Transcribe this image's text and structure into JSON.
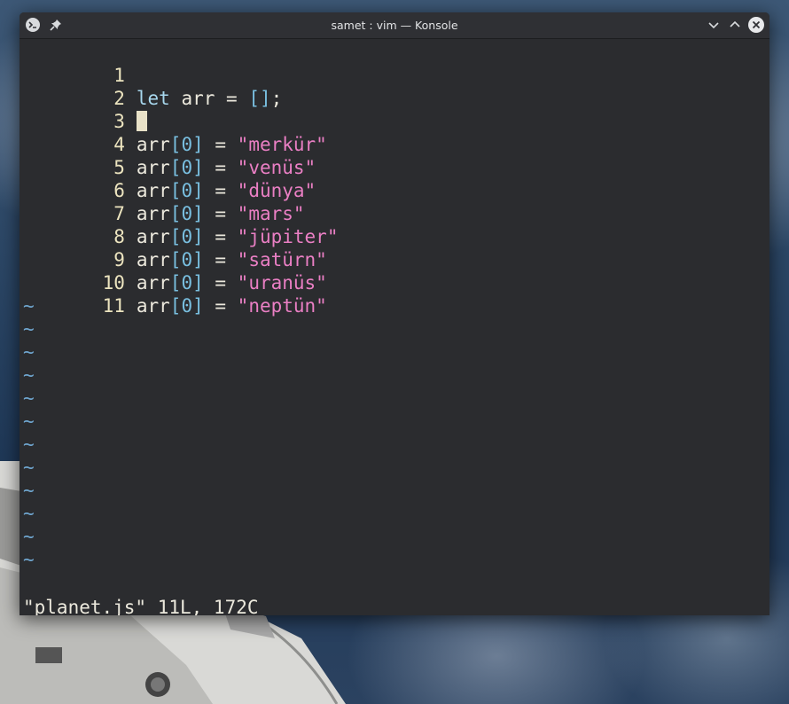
{
  "window": {
    "title": "samet : vim — Konsole"
  },
  "icons": {
    "app": "terminal-app-icon",
    "pin": "pin-icon",
    "minimize": "chevron-down-icon",
    "maximize": "chevron-up-icon",
    "close": "close-icon"
  },
  "editor": {
    "lines": [
      {
        "num": "1",
        "text": ""
      },
      {
        "num": "2",
        "kw": "let",
        "mid": " arr = ",
        "br": "[]",
        "end": ";"
      },
      {
        "num": "3",
        "text": ""
      },
      {
        "num": "4",
        "pre": "arr",
        "idx": "[0]",
        "eq": " = ",
        "str": "\"merkür\""
      },
      {
        "num": "5",
        "pre": "arr",
        "idx": "[0]",
        "eq": " = ",
        "str": "\"venüs\""
      },
      {
        "num": "6",
        "pre": "arr",
        "idx": "[0]",
        "eq": " = ",
        "str": "\"dünya\""
      },
      {
        "num": "7",
        "pre": "arr",
        "idx": "[0]",
        "eq": " = ",
        "str": "\"mars\""
      },
      {
        "num": "8",
        "pre": "arr",
        "idx": "[0]",
        "eq": " = ",
        "str": "\"jüpiter\""
      },
      {
        "num": "9",
        "pre": "arr",
        "idx": "[0]",
        "eq": " = ",
        "str": "\"satürn\""
      },
      {
        "num": "10",
        "pre": "arr",
        "idx": "[0]",
        "eq": " = ",
        "str": "\"uranüs\""
      },
      {
        "num": "11",
        "pre": "arr",
        "idx": "[0]",
        "eq": " = ",
        "str": "\"neptün\""
      }
    ],
    "tilde": "~",
    "status": "\"planet.js\" 11L, 172C"
  }
}
